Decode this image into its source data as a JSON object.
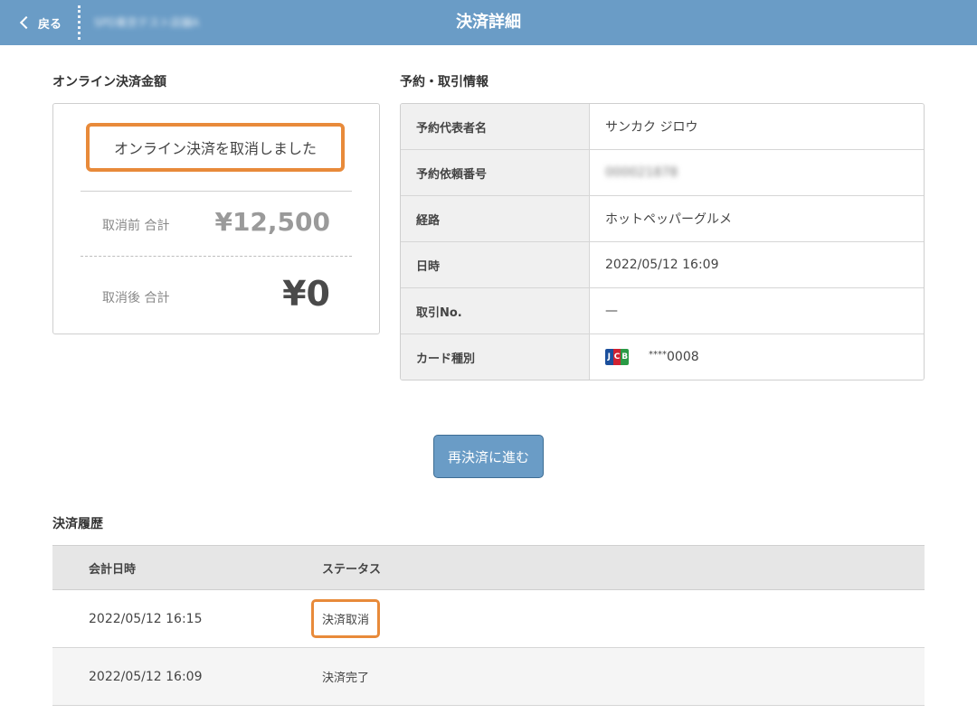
{
  "header": {
    "back_label": "戻る",
    "store_name": "SPD東京テスト店舗A",
    "title": "決済詳細"
  },
  "amount_section": {
    "title": "オンライン決済金額",
    "cancel_message": "オンライン決済を取消しました",
    "before_label": "取消前 合計",
    "before_value": "¥12,500",
    "after_label": "取消後 合計",
    "after_value": "¥0"
  },
  "info_section": {
    "title": "予約・取引情報",
    "rows": [
      {
        "key": "予約代表者名",
        "value": "サンカク ジロウ"
      },
      {
        "key": "予約依頼番号",
        "value": "000021878"
      },
      {
        "key": "経路",
        "value": "ホットペッパーグルメ"
      },
      {
        "key": "日時",
        "value": "2022/05/12 16:09"
      },
      {
        "key": "取引No.",
        "value": "—"
      },
      {
        "key": "カード種別",
        "value": "0008",
        "stars": "****",
        "card_brand": "JCB"
      }
    ]
  },
  "resettle_button": "再決済に進む",
  "history": {
    "title": "決済履歴",
    "col_date": "会計日時",
    "col_status": "ステータス",
    "rows": [
      {
        "date": "2022/05/12 16:15",
        "status": "決済取消"
      },
      {
        "date": "2022/05/12 16:09",
        "status": "決済完了"
      }
    ]
  },
  "colors": {
    "header_bg": "#6a9cc6",
    "highlight": "#e88a3a"
  }
}
